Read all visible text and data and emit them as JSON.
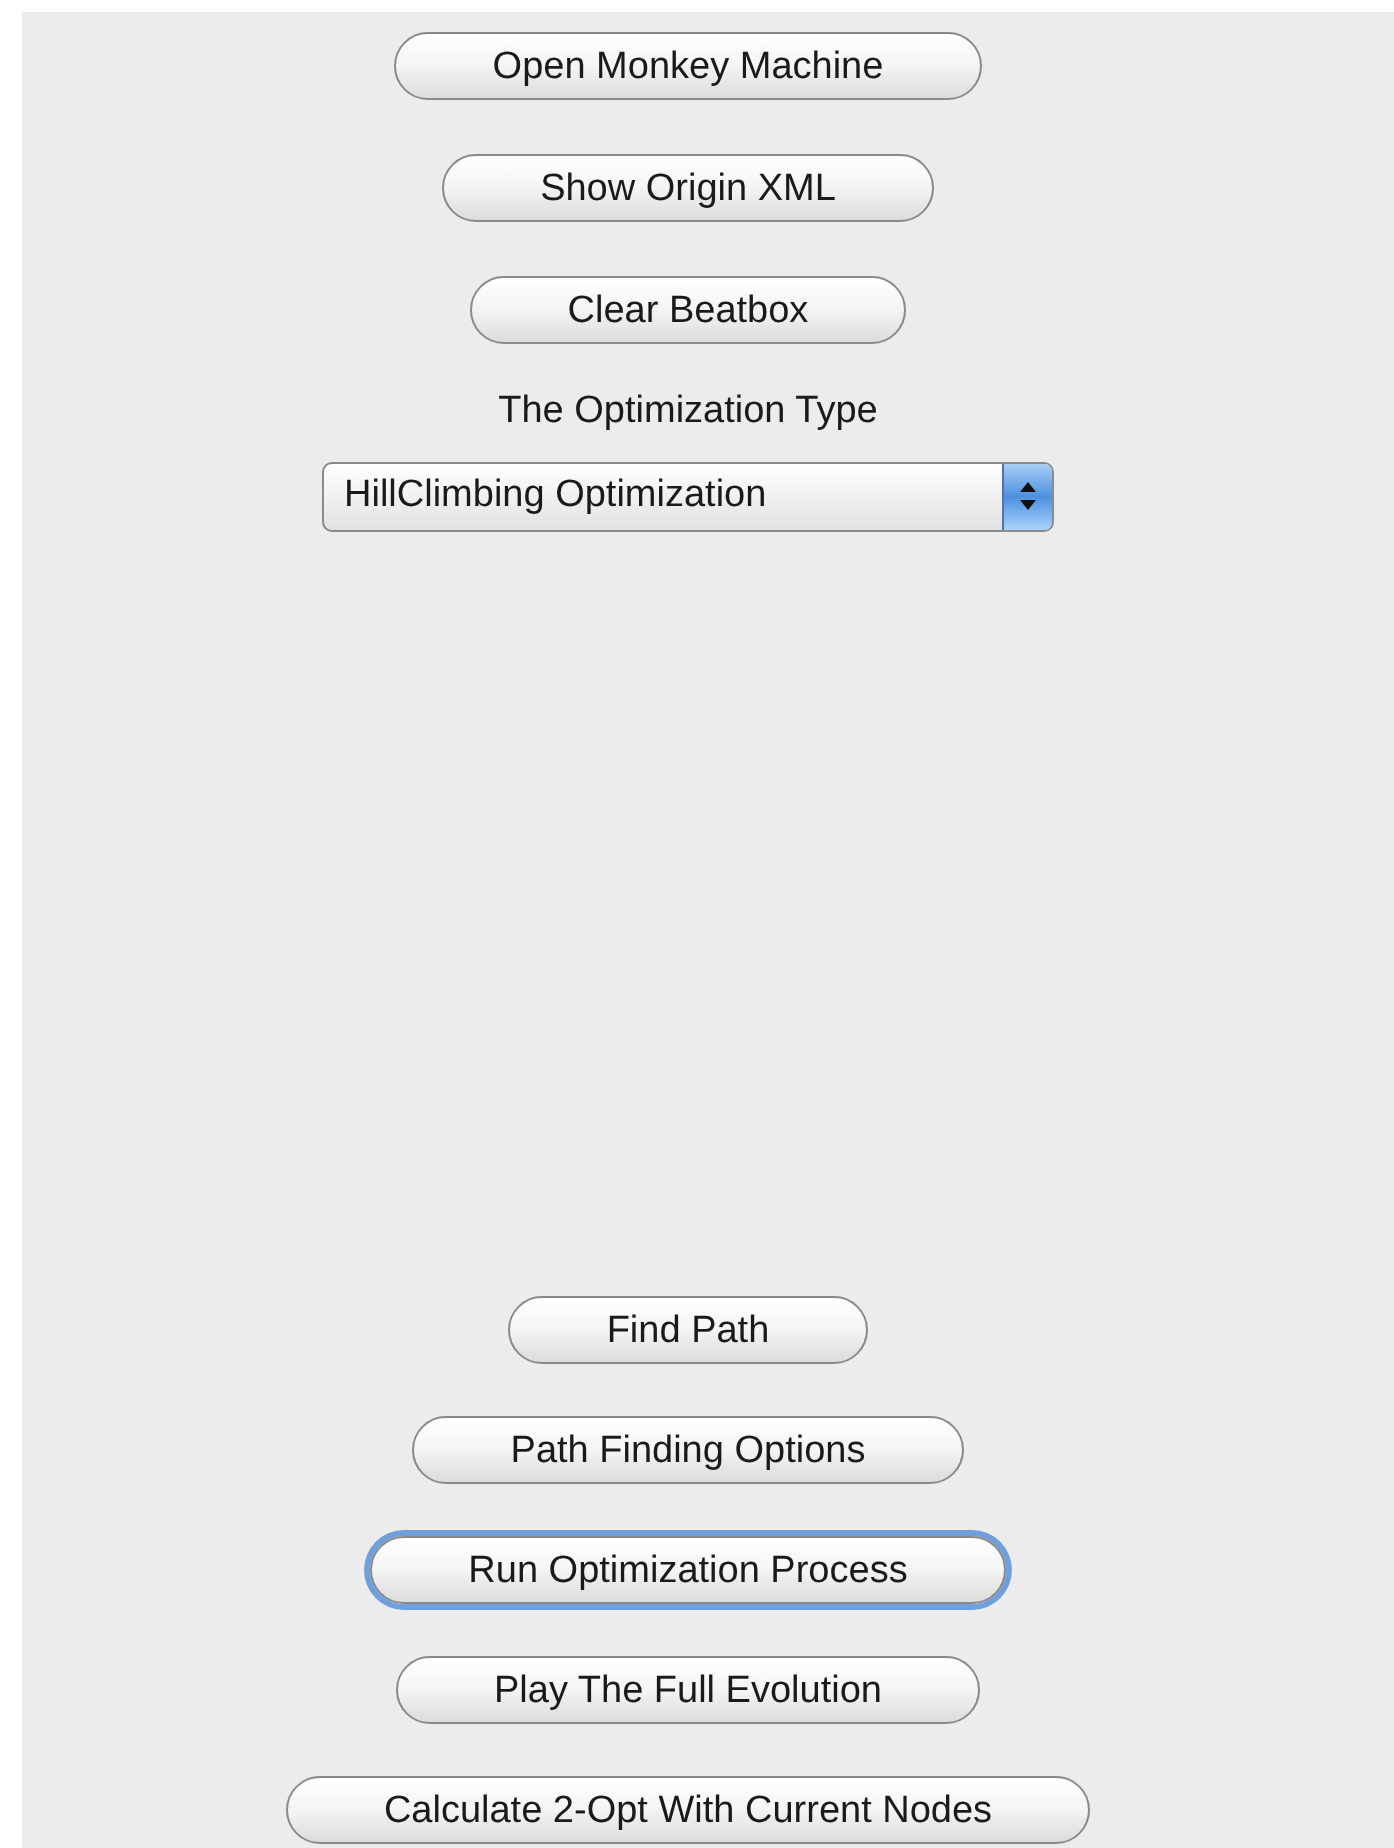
{
  "top_buttons": [
    {
      "label": "Open Monkey Machine",
      "focused": false
    },
    {
      "label": "Show Origin XML",
      "focused": false
    },
    {
      "label": "Clear Beatbox",
      "focused": false
    }
  ],
  "optimization_type": {
    "label": "The Optimization Type",
    "value": "HillClimbing Optimization"
  },
  "bottom_buttons": [
    {
      "label": "Find Path",
      "focused": false
    },
    {
      "label": "Path Finding Options",
      "focused": false
    },
    {
      "label": "Run Optimization Process",
      "focused": true
    },
    {
      "label": "Play The Full Evolution",
      "focused": false
    },
    {
      "label": "Calculate 2-Opt With Current Nodes",
      "focused": false
    }
  ]
}
